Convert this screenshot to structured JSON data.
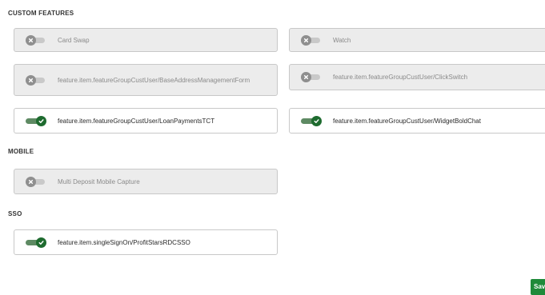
{
  "sections": {
    "custom_features": "CUSTOM FEATURES",
    "mobile": "MOBILE",
    "sso": "SSO"
  },
  "features": {
    "card_swap": {
      "label": "Card Swap",
      "enabled": false
    },
    "watch": {
      "label": "Watch",
      "enabled": false
    },
    "base_address": {
      "label": "feature.item.featureGroupCustUser/BaseAddressManagementForm",
      "enabled": false
    },
    "click_switch": {
      "label": "feature.item.featureGroupCustUser/ClickSwitch",
      "enabled": false
    },
    "loan_payments": {
      "label": "feature.item.featureGroupCustUser/LoanPaymentsTCT",
      "enabled": true
    },
    "widget_bold_chat": {
      "label": "feature.item.featureGroupCustUser/WidgetBoldChat",
      "enabled": true
    },
    "multi_deposit": {
      "label": "Multi Deposit Mobile Capture",
      "enabled": false
    },
    "profitstars_sso": {
      "label": "feature.item.singleSignOn/ProfitStarsRDCSSO",
      "enabled": true
    }
  },
  "actions": {
    "save_label": "Save"
  },
  "colors": {
    "toggle_on": "#1e6b2f",
    "toggle_off": "#8f8f8f",
    "save_button": "#1f8a3a"
  },
  "icons": {
    "on": "checkmark-icon",
    "off": "x-icon"
  }
}
